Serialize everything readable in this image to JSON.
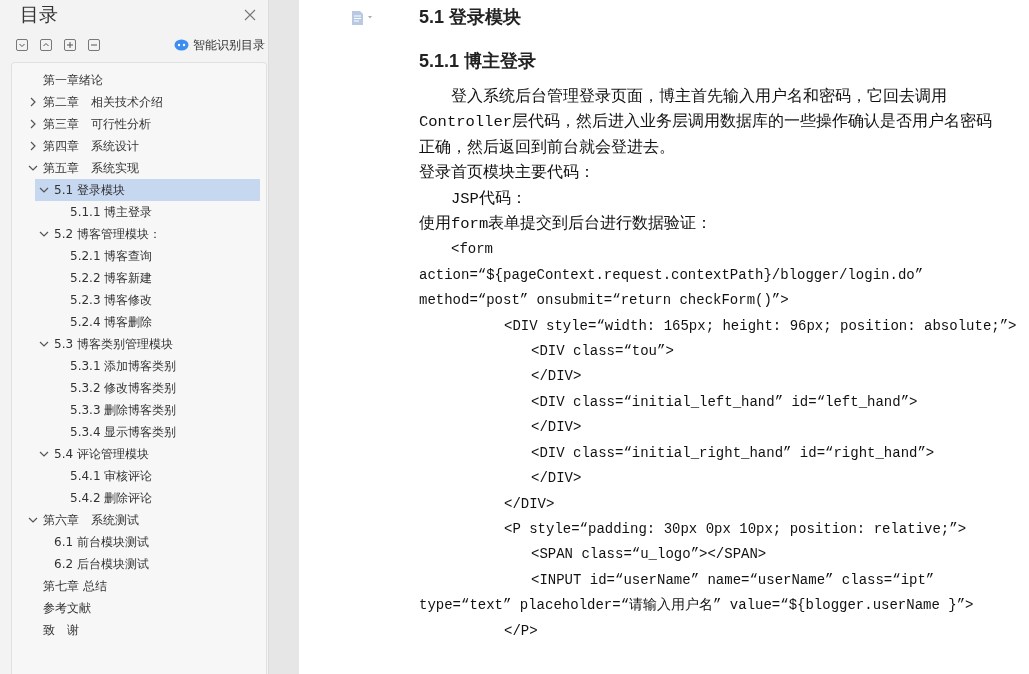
{
  "sidebar": {
    "title": "目录",
    "smart_toc_label": "智能识别目录",
    "toc": [
      {
        "label": "第一章绪论",
        "selected": false
      },
      {
        "label": "第二章　相关技术介绍",
        "selected": false,
        "expanded": false
      },
      {
        "label": "第三章　可行性分析",
        "selected": false,
        "expanded": false
      },
      {
        "label": "第四章　系统设计",
        "selected": false,
        "expanded": false
      },
      {
        "label": "第五章　系统实现",
        "selected": false,
        "expanded": true,
        "children": [
          {
            "label": "5.1  登录模块",
            "selected": true,
            "expanded": true,
            "children": [
              {
                "label": "5.1.1  博主登录",
                "selected": false
              }
            ]
          },
          {
            "label": "5.2  博客管理模块：",
            "selected": false,
            "expanded": true,
            "children": [
              {
                "label": "5.2.1  博客查询",
                "selected": false
              },
              {
                "label": "5.2.2  博客新建",
                "selected": false
              },
              {
                "label": "5.2.3  博客修改",
                "selected": false
              },
              {
                "label": "5.2.4  博客删除",
                "selected": false
              }
            ]
          },
          {
            "label": "5.3  博客类别管理模块",
            "selected": false,
            "expanded": true,
            "children": [
              {
                "label": "5.3.1  添加博客类别",
                "selected": false
              },
              {
                "label": "5.3.2  修改博客类别",
                "selected": false
              },
              {
                "label": "5.3.3  删除博客类别",
                "selected": false
              },
              {
                "label": "5.3.4  显示博客类别",
                "selected": false
              }
            ]
          },
          {
            "label": "5.4  评论管理模块",
            "selected": false,
            "expanded": true,
            "children": [
              {
                "label": "5.4.1  审核评论",
                "selected": false
              },
              {
                "label": "5.4.2  删除评论",
                "selected": false
              }
            ]
          }
        ]
      },
      {
        "label": "第六章　系统测试",
        "selected": false,
        "expanded": true,
        "children": [
          {
            "label": "6.1  前台模块测试",
            "selected": false
          },
          {
            "label": "6.2  后台模块测试",
            "selected": false
          }
        ]
      },
      {
        "label": "第七章 总结",
        "selected": false
      },
      {
        "label": "参考文献",
        "selected": false
      },
      {
        "label": "致　谢",
        "selected": false
      }
    ]
  },
  "document": {
    "blocks": [
      {
        "kind": "heading",
        "text": "5.1  登录模块"
      },
      {
        "kind": "heading",
        "text": "5.1.1  博主登录"
      },
      {
        "kind": "paragraph-indented",
        "text": "登入系统后台管理登录页面，博主首先输入用户名和密码，它回去调用Controller层代码，然后进入业务层调用数据库的一些操作确认是否用户名密码正确，然后返回到前台就会登进去。"
      },
      {
        "kind": "paragraph",
        "text": "登录首页模块主要代码："
      },
      {
        "kind": "paragraph-indented",
        "text": "JSP代码："
      },
      {
        "kind": "paragraph",
        "text": "使用form表单提交到后台进行数据验证："
      },
      {
        "kind": "code-indented",
        "text": "<form"
      },
      {
        "kind": "code",
        "text": "action=“${pageContext.request.contextPath}/blogger/login.do”"
      },
      {
        "kind": "code",
        "text": "method=“post” onsubmit=“return checkForm()”>"
      },
      {
        "kind": "code-block",
        "text": "<DIV style=“width: 165px; height: 96px; position: absolute;”>"
      },
      {
        "kind": "code-nested",
        "text": "<DIV class=“tou”>"
      },
      {
        "kind": "code-nested",
        "text": "</DIV>"
      },
      {
        "kind": "code-nested",
        "text": "<DIV class=“initial_left_hand” id=“left_hand”>"
      },
      {
        "kind": "code-nested",
        "text": "</DIV>"
      },
      {
        "kind": "code-nested",
        "text": "<DIV class=“initial_right_hand” id=“right_hand”>"
      },
      {
        "kind": "code-nested",
        "text": "</DIV>"
      },
      {
        "kind": "code-block",
        "text": "</DIV>"
      },
      {
        "kind": "code-block",
        "text": "<P style=“padding: 30px 0px 10px; position: relative;”>"
      },
      {
        "kind": "code-nested",
        "text": "<SPAN class=“u_logo”></SPAN>"
      },
      {
        "kind": "code-nested",
        "text": "<INPUT id=“userName” name=“userName” class=“ipt”"
      },
      {
        "kind": "code",
        "text": "type=“text” placeholder=“请输入用户名” value=“${blogger.userName }”>"
      },
      {
        "kind": "code-block",
        "text": "</P>"
      }
    ]
  }
}
